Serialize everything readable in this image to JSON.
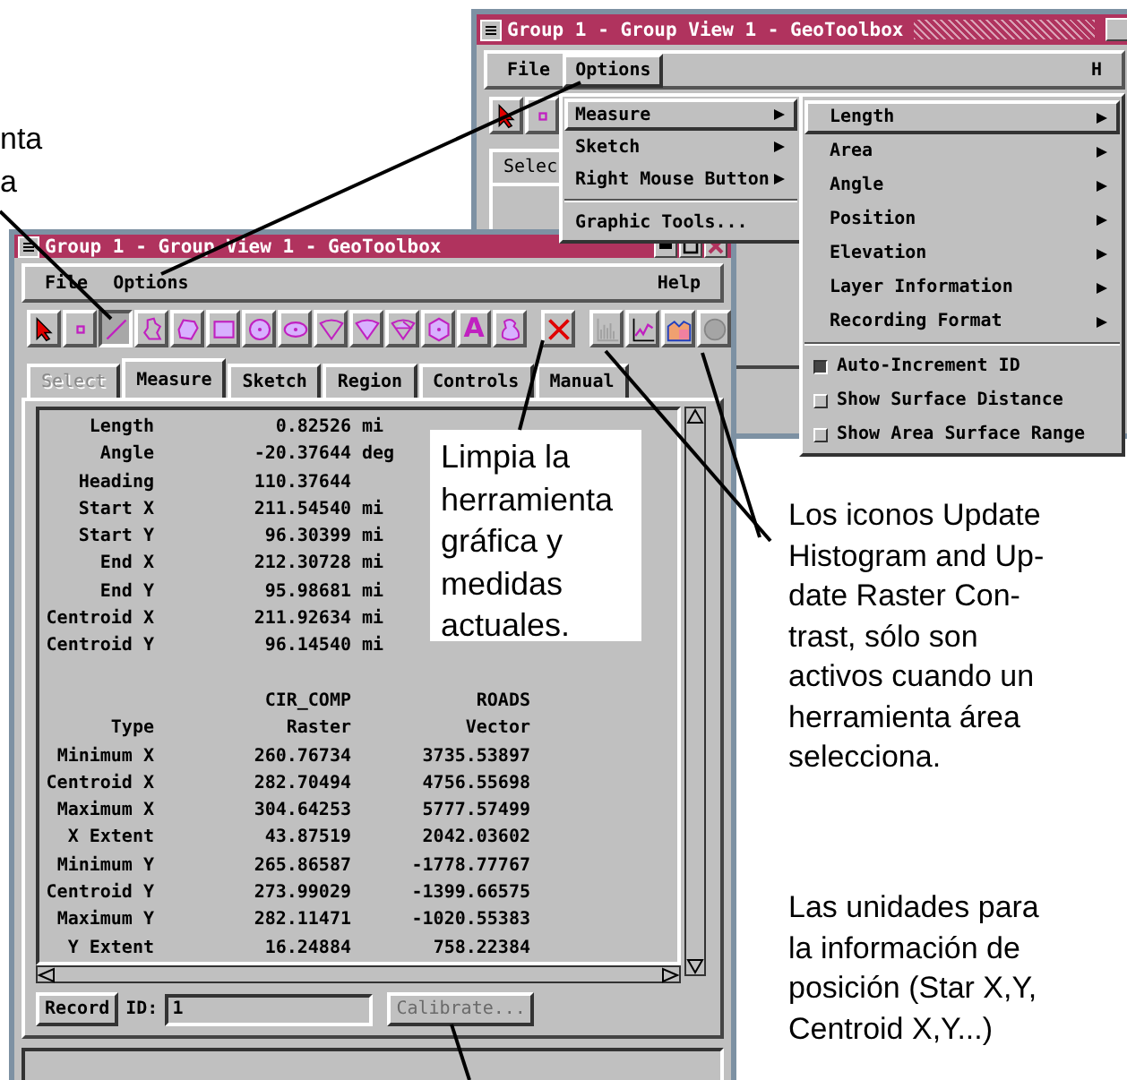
{
  "left_note": "nta\na",
  "back_window": {
    "title": "Group 1 - Group View 1 - GeoToolbox",
    "menus": [
      {
        "label": "File",
        "selected": false
      },
      {
        "label": "Options",
        "selected": true
      },
      {
        "label": "H",
        "selected": false
      }
    ],
    "tools": [
      {
        "kind": "pointer"
      },
      {
        "kind": "point"
      }
    ],
    "tabs": [
      {
        "label": "Selec"
      }
    ]
  },
  "options_menu": {
    "items": [
      {
        "kind": "submenu",
        "label": "Measure",
        "selected": true
      },
      {
        "kind": "submenu",
        "label": "Sketch",
        "selected": false
      },
      {
        "kind": "submenu",
        "label": "Right Mouse Button",
        "selected": false
      },
      {
        "kind": "separator"
      },
      {
        "kind": "command",
        "label": "Graphic Tools...",
        "selected": false
      }
    ]
  },
  "measure_submenu": {
    "items": [
      {
        "kind": "submenu",
        "label": "Length",
        "selected": true
      },
      {
        "kind": "submenu",
        "label": "Area",
        "selected": false
      },
      {
        "kind": "submenu",
        "label": "Angle",
        "selected": false
      },
      {
        "kind": "submenu",
        "label": "Position",
        "selected": false
      },
      {
        "kind": "submenu",
        "label": "Elevation",
        "selected": false
      },
      {
        "kind": "submenu",
        "label": "Layer Information",
        "selected": false
      },
      {
        "kind": "submenu",
        "label": "Recording Format",
        "selected": false
      },
      {
        "kind": "separator"
      },
      {
        "kind": "toggle",
        "label": "Auto-Increment ID",
        "checked": true
      },
      {
        "kind": "toggle",
        "label": "Show Surface Distance",
        "checked": false
      },
      {
        "kind": "toggle",
        "label": "Show Area Surface Range",
        "checked": false
      }
    ]
  },
  "front_window": {
    "title": "Group 1 - Group View 1 - GeoToolbox",
    "menus": [
      {
        "label": "File"
      },
      {
        "label": "Options"
      },
      {
        "label": "Help"
      }
    ],
    "toolbar": [
      [
        {
          "kind": "pointer",
          "selected": false,
          "disabled": false
        },
        {
          "kind": "point",
          "selected": false,
          "disabled": false
        },
        {
          "kind": "line",
          "selected": true,
          "disabled": false
        },
        {
          "kind": "polyline",
          "selected": false,
          "disabled": false
        },
        {
          "kind": "polygon",
          "selected": false,
          "disabled": false
        },
        {
          "kind": "rectangle",
          "selected": false,
          "disabled": false
        },
        {
          "kind": "circle",
          "selected": false,
          "disabled": false
        },
        {
          "kind": "ellipse",
          "selected": false,
          "disabled": false
        },
        {
          "kind": "wedge",
          "selected": false,
          "disabled": false
        },
        {
          "kind": "sector",
          "selected": false,
          "disabled": false
        },
        {
          "kind": "segment",
          "selected": false,
          "disabled": false
        },
        {
          "kind": "hexagon",
          "selected": false,
          "disabled": false
        },
        {
          "kind": "text",
          "label": "A",
          "selected": false,
          "disabled": false
        },
        {
          "kind": "bucket",
          "selected": false,
          "disabled": false
        }
      ],
      [
        {
          "kind": "clear",
          "selected": false,
          "disabled": false
        }
      ],
      [
        {
          "kind": "histogram",
          "selected": false,
          "disabled": true
        },
        {
          "kind": "profile",
          "selected": false,
          "disabled": false
        },
        {
          "kind": "area",
          "selected": false,
          "disabled": false
        },
        {
          "kind": "contrast",
          "selected": false,
          "disabled": true
        }
      ]
    ],
    "tabs": [
      {
        "label": "Select",
        "selected": false,
        "disabled": true
      },
      {
        "label": "Measure",
        "selected": true,
        "disabled": false
      },
      {
        "label": "Sketch",
        "selected": false,
        "disabled": false
      },
      {
        "label": "Region",
        "selected": false,
        "disabled": false
      },
      {
        "label": "Controls",
        "selected": false,
        "disabled": false
      },
      {
        "label": "Manual",
        "selected": false,
        "disabled": false
      }
    ],
    "measurements": [
      {
        "label": "Length",
        "value": "0.82526",
        "unit": "mi"
      },
      {
        "label": "Angle",
        "value": "-20.37644",
        "unit": "deg"
      },
      {
        "label": "Heading",
        "value": "110.37644"
      },
      {
        "label": "Start X",
        "value": "211.54540",
        "unit": "mi"
      },
      {
        "label": "Start Y",
        "value": "96.30399",
        "unit": "mi"
      },
      {
        "label": "End X",
        "value": "212.30728",
        "unit": "mi"
      },
      {
        "label": "End Y",
        "value": "95.98681",
        "unit": "mi"
      },
      {
        "label": "Centroid X",
        "value": "211.92634",
        "unit": "mi"
      },
      {
        "label": "Centroid Y",
        "value": "96.14540",
        "unit": "mi"
      }
    ],
    "layer_table": {
      "columns": [
        "CIR_COMP",
        "ROADS"
      ],
      "rows": [
        {
          "label": "Type",
          "values": [
            "Raster",
            "Vector"
          ]
        },
        {
          "label": "Minimum X",
          "values": [
            "260.76734",
            "3735.53897"
          ]
        },
        {
          "label": "Centroid X",
          "values": [
            "282.70494",
            "4756.55698"
          ]
        },
        {
          "label": "Maximum X",
          "values": [
            "304.64253",
            "5777.57499"
          ]
        },
        {
          "label": "X Extent",
          "values": [
            "43.87519",
            "2042.03602"
          ]
        },
        {
          "label": "Minimum Y",
          "values": [
            "265.86587",
            "-1778.77767"
          ]
        },
        {
          "label": "Centroid Y",
          "values": [
            "273.99029",
            "-1399.66575"
          ]
        },
        {
          "label": "Maximum Y",
          "values": [
            "282.11471",
            "-1020.55383"
          ]
        },
        {
          "label": "Y Extent",
          "values": [
            "16.24884",
            "758.22384"
          ]
        }
      ]
    },
    "record_button": "Record",
    "id_label": "ID:",
    "id_field": {
      "value": "1"
    },
    "calibrate_button": {
      "label": "Calibrate...",
      "disabled": true
    }
  },
  "callout": "Limpia la herramienta gráfica y medidas actuales.",
  "notes": [
    "Los iconos Update\nHistogram and Up-\ndate Raster Con-\ntrast, sólo son\nactivos cuando un\nherramienta área\nselecciona.",
    "Las unidades para\nla información de\nposición (Star X,Y,\nCentroid X,Y...)"
  ]
}
